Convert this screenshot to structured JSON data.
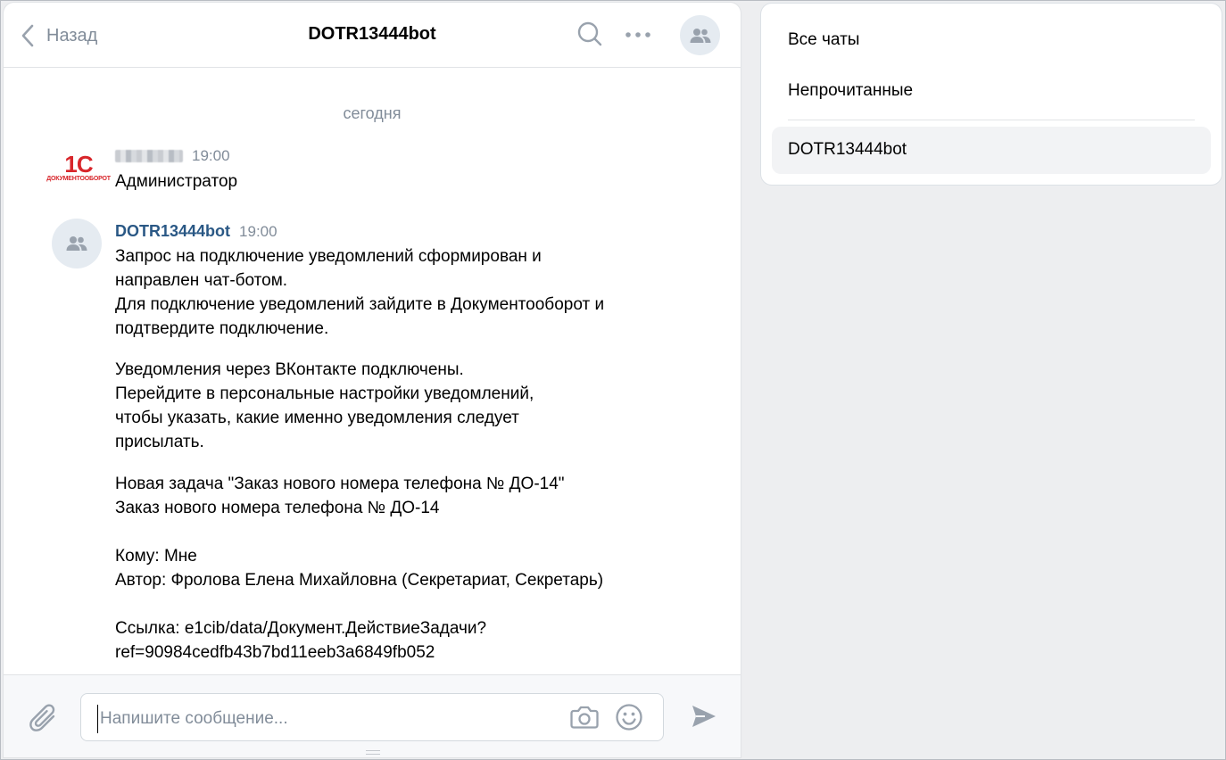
{
  "header": {
    "back_label": "Назад",
    "title": "DOTR13444bot"
  },
  "messages": {
    "date_separator": "сегодня",
    "first": {
      "logo_text": "1С",
      "logo_subtext": "ДОКУМЕНТООБОРОТ",
      "time": "19:00",
      "text": "Администратор"
    },
    "second": {
      "author": "DOTR13444bot",
      "time": "19:00",
      "paragraphs": [
        "Запрос на подключение уведомлений сформирован и\nнаправлен чат-ботом.\nДля подключение уведомлений зайдите в Документооборот и\nподтвердите подключение.",
        "Уведомления через ВКонтакте подключены.\nПерейдите в персональные настройки уведомлений,\nчтобы указать, какие именно уведомления следует\nприсылать.",
        "Новая задача \"Заказ нового номера телефона № ДО-14\"\nЗаказ нового номера телефона № ДО-14\n\nКому: Мне\nАвтор: Фролова Елена Михайловна (Секретариат, Секретарь)\n\nСсылка: e1cib/data/Документ.ДействиеЗадачи?\nref=90984cedfb43b7bd11eeb3a6849fb052"
      ]
    }
  },
  "composer": {
    "placeholder": "Напишите сообщение..."
  },
  "sidebar": {
    "items": [
      "Все чаты",
      "Непрочитанные"
    ],
    "active_chat": "DOTR13444bot"
  },
  "colors": {
    "link": "#2a5885",
    "muted": "#818c99",
    "icon": "#99a2ad",
    "logo_red": "#d8262b"
  },
  "icons": [
    "chevron-left-icon",
    "search-icon",
    "more-icon",
    "group-icon",
    "paperclip-icon",
    "camera-icon",
    "smile-icon",
    "send-icon"
  ]
}
